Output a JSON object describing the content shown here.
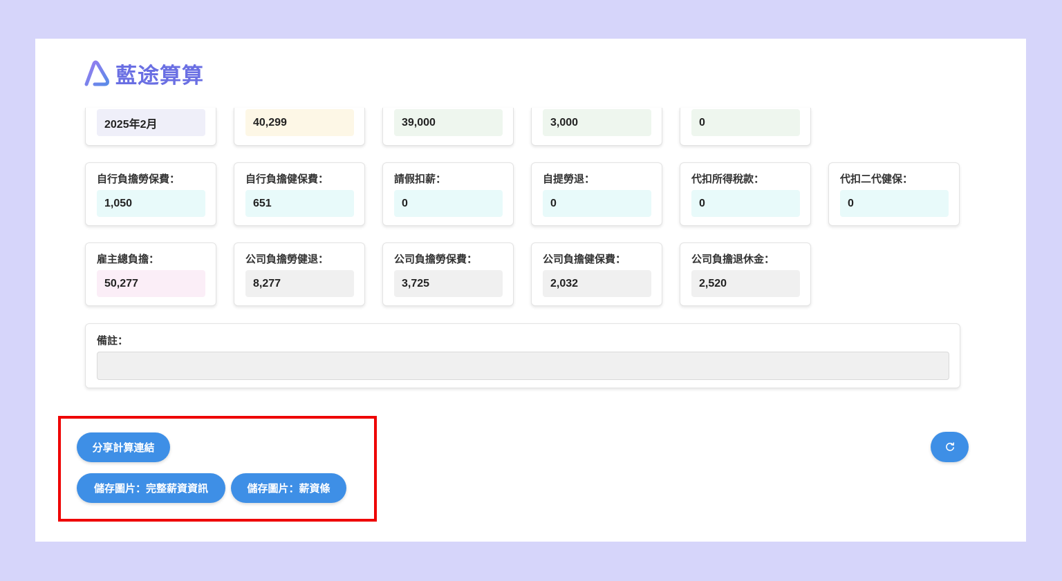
{
  "app": {
    "title": "藍途算算"
  },
  "row1": [
    {
      "value": "2025年2月"
    },
    {
      "value": "40,299"
    },
    {
      "value": "39,000"
    },
    {
      "value": "3,000"
    },
    {
      "value": "0"
    }
  ],
  "row2": [
    {
      "label": "自行負擔勞保費：",
      "value": "1,050"
    },
    {
      "label": "自行負擔健保費：",
      "value": "651"
    },
    {
      "label": "請假扣薪：",
      "value": "0"
    },
    {
      "label": "自提勞退：",
      "value": "0"
    },
    {
      "label": "代扣所得稅款：",
      "value": "0"
    },
    {
      "label": "代扣二代健保：",
      "value": "0"
    }
  ],
  "row3": [
    {
      "label": "雇主總負擔：",
      "value": "50,277"
    },
    {
      "label": "公司負擔勞健退：",
      "value": "8,277"
    },
    {
      "label": "公司負擔勞保費：",
      "value": "3,725"
    },
    {
      "label": "公司負擔健保費：",
      "value": "2,032"
    },
    {
      "label": "公司負擔退休金：",
      "value": "2,520"
    }
  ],
  "notes": {
    "label": "備註：",
    "value": ""
  },
  "actions": {
    "share_label": "分享計算連結",
    "save_full_label": "儲存圖片：完整薪資資訊",
    "save_slip_label": "儲存圖片：薪資條",
    "refresh_icon": "refresh-icon"
  },
  "colors": {
    "accent": "#3e8fe6",
    "brand": "#6a6fe3",
    "page_bg": "#d6d5fa",
    "highlight": "#ee0000"
  }
}
